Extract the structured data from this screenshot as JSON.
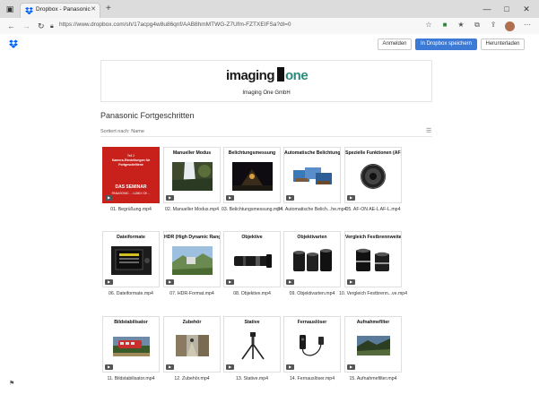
{
  "browser": {
    "tab_title": "Dropbox - Panasonic Fortgeschritt",
    "url": "https://www.dropbox.com/sh/17acpg4w8u86qnf/AAB8hmMTWG-Z7Ufm-FZTXEIFSa?dl=0"
  },
  "actions": {
    "login": "Anmelden",
    "save": "In Dropbox speichern",
    "download": "Herunterladen"
  },
  "header": {
    "logo_word": "imaging",
    "logo_one": "one",
    "company": "Imaging One GmbH"
  },
  "folder": {
    "title": "Panasonic Fortgeschritten",
    "sort": "Sortiert nach: Name"
  },
  "seminar_card": {
    "lines": [
      "Teil 2",
      "Kamera-Einstellungen für Fortgeschrittene"
    ],
    "headline": "DAS SEMINAR",
    "footer": "PANASONIC ... LUMIX G9 ..."
  },
  "files": [
    {
      "name": "01. Begrüßung.mp4",
      "title": "",
      "thumb": "seminar"
    },
    {
      "name": "02. Manueller Modus.mp4",
      "title": "Manueller Modus",
      "thumb": "waterfall"
    },
    {
      "name": "03. Belichtungsmessung.mp4",
      "title": "Belichtungsmessung",
      "thumb": "night"
    },
    {
      "name": "04. Automatische Belich...he.mp4",
      "title": "Automatische Belichtungsreihe",
      "thumb": "bracket"
    },
    {
      "name": "05. AF-ON AE-L AF-L.mp4",
      "title": "Spezielle Funktionen (AF-ON, AE-L, AF-L)",
      "thumb": "camera-back"
    },
    {
      "name": "06. Dateiformate.mp4",
      "title": "Dateiformate",
      "thumb": "screen"
    },
    {
      "name": "07. HDR-Format.mp4",
      "title": "HDR (High Dynamic Range)",
      "thumb": "landscape"
    },
    {
      "name": "08. Objektive.mp4",
      "title": "Objektive",
      "thumb": "lens-long"
    },
    {
      "name": "09. Objektivarten.mp4",
      "title": "Objektivarten",
      "thumb": "lenses"
    },
    {
      "name": "10. Vergleich Festbrenn...ve.mp4",
      "title": "Vergleich Festbrennweite / Zoomobjektive",
      "thumb": "lenses2"
    },
    {
      "name": "11. Bildstabilisator.mp4",
      "title": "Bildstabilisator",
      "thumb": "train"
    },
    {
      "name": "12. Zubehör.mp4",
      "title": "Zubehör",
      "thumb": "street"
    },
    {
      "name": "13. Stative.mp4",
      "title": "Stative",
      "thumb": "tripod"
    },
    {
      "name": "14. Fernauslöser.mp4",
      "title": "Fernauslöser",
      "thumb": "remote"
    },
    {
      "name": "15. Aufnahmefilter.mp4",
      "title": "Aufnahmefilter",
      "thumb": "filter"
    }
  ]
}
